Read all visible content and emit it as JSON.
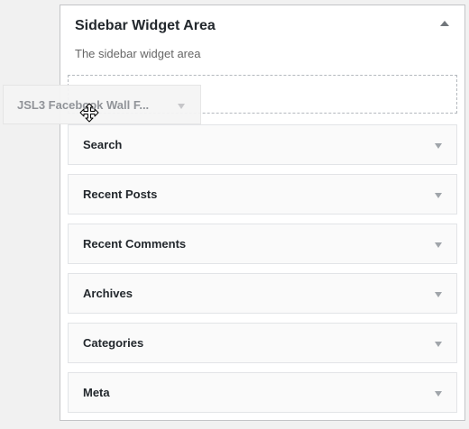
{
  "sidebar_area": {
    "title": "Sidebar Widget Area",
    "description": "The sidebar widget area",
    "toggle_icon": "arrow-up-icon"
  },
  "widgets": [
    {
      "title": "Search",
      "icon": "arrow-down-icon"
    },
    {
      "title": "Recent Posts",
      "icon": "arrow-down-icon"
    },
    {
      "title": "Recent Comments",
      "icon": "arrow-down-icon"
    },
    {
      "title": "Archives",
      "icon": "arrow-down-icon"
    },
    {
      "title": "Categories",
      "icon": "arrow-down-icon"
    },
    {
      "title": "Meta",
      "icon": "arrow-down-icon"
    }
  ],
  "dragging_widget": {
    "title": "JSL3 Facebook Wall F...",
    "icon": "arrow-down-icon",
    "cursor_icon": "move-cursor-icon"
  }
}
